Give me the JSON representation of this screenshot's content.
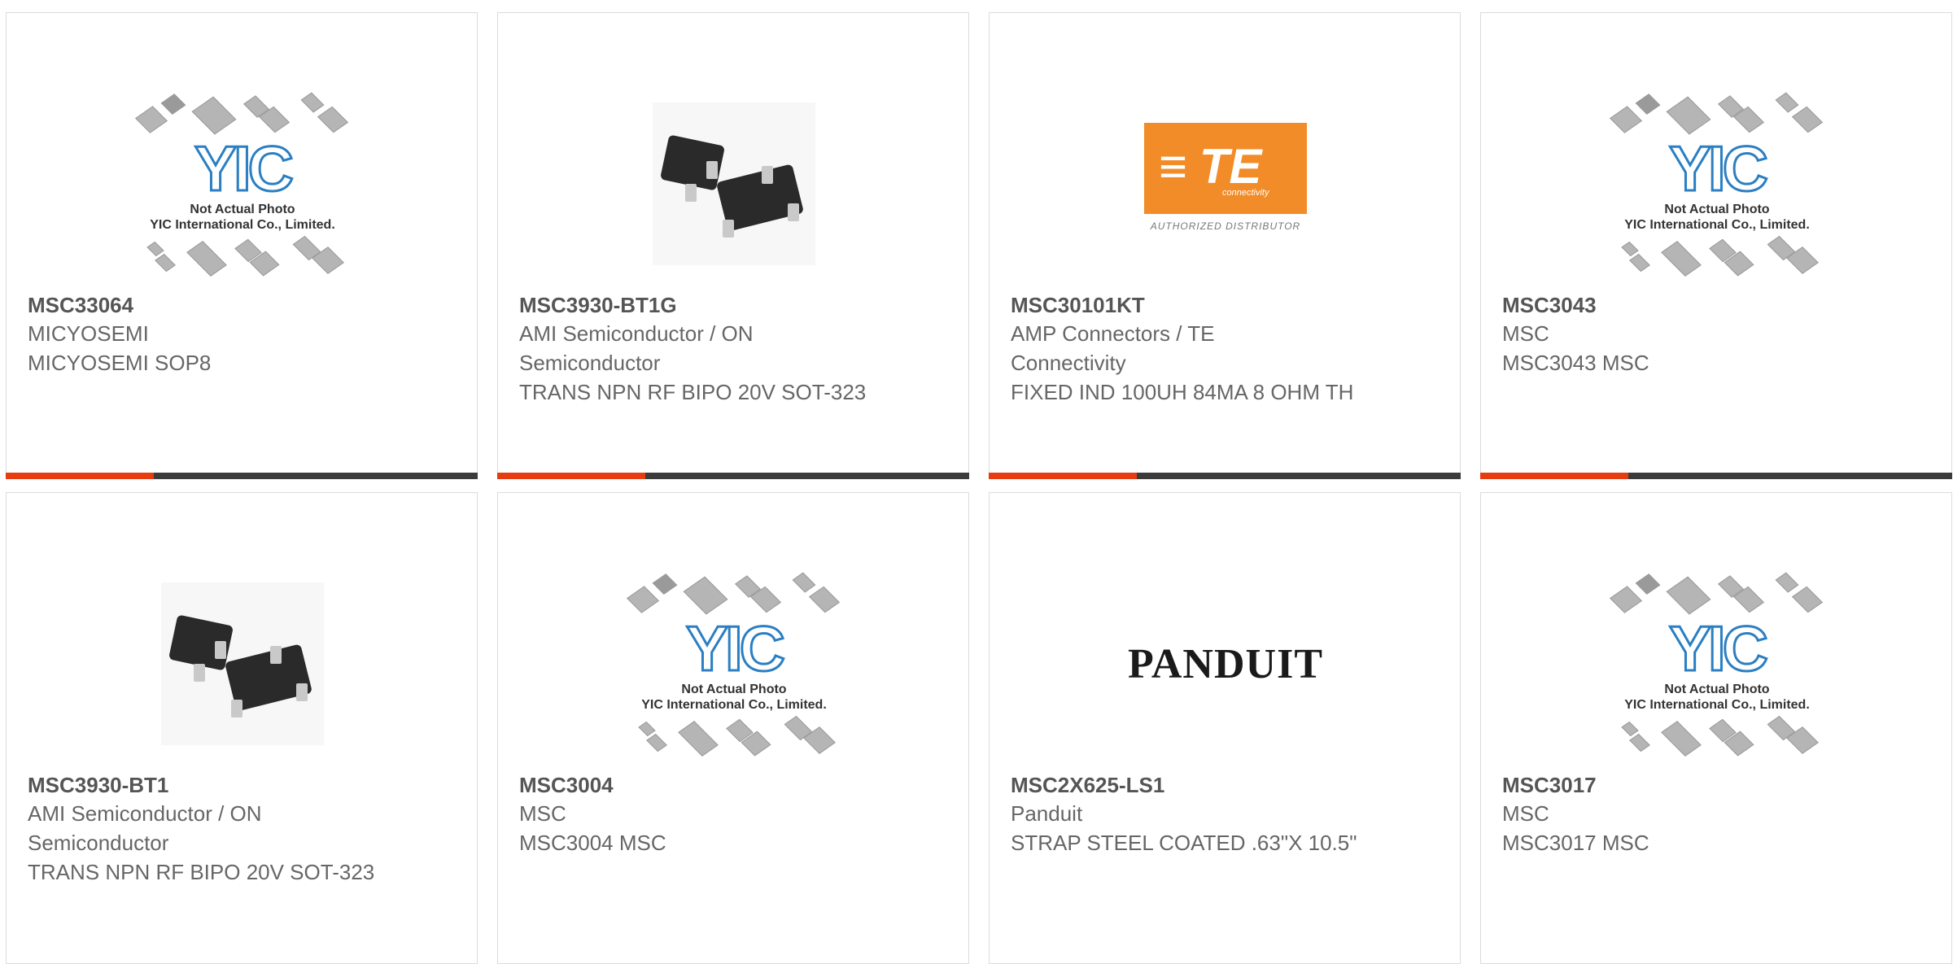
{
  "placeholder": {
    "logo": "YIC",
    "caption_line1": "Not Actual Photo",
    "caption_line2": "YIC International Co., Limited."
  },
  "te_logo": {
    "mark": "TE",
    "sub": "connectivity",
    "authorized": "AUTHORIZED DISTRIBUTOR"
  },
  "panduit_logo": "PANDUIT",
  "colors": {
    "accent": "#e63c12",
    "bar": "#3b3b3b",
    "border": "#dcdcdc",
    "te_orange": "#f28c28"
  },
  "products": [
    {
      "part": "MSC33064",
      "manufacturer": "MICYOSEMI",
      "description": "MICYOSEMI SOP8",
      "image": "yic-placeholder"
    },
    {
      "part": "MSC3930-BT1G",
      "manufacturer": "AMI Semiconductor / ON Semiconductor",
      "description": "TRANS NPN RF BIPO 20V SOT-323",
      "image": "transistor-photo"
    },
    {
      "part": "MSC30101KT",
      "manufacturer": "AMP Connectors / TE Connectivity",
      "description": "FIXED IND 100UH 84MA 8 OHM TH",
      "image": "te-logo"
    },
    {
      "part": "MSC3043",
      "manufacturer": "MSC",
      "description": "MSC3043 MSC",
      "image": "yic-placeholder"
    },
    {
      "part": "MSC3930-BT1",
      "manufacturer": "AMI Semiconductor / ON Semiconductor",
      "description": "TRANS NPN RF BIPO 20V SOT-323",
      "image": "transistor-photo"
    },
    {
      "part": "MSC3004",
      "manufacturer": "MSC",
      "description": "MSC3004 MSC",
      "image": "yic-placeholder"
    },
    {
      "part": "MSC2X625-LS1",
      "manufacturer": "Panduit",
      "description": "STRAP STEEL COATED .63\"X 10.5\"",
      "image": "panduit-logo"
    },
    {
      "part": "MSC3017",
      "manufacturer": "MSC",
      "description": "MSC3017 MSC",
      "image": "yic-placeholder"
    }
  ]
}
